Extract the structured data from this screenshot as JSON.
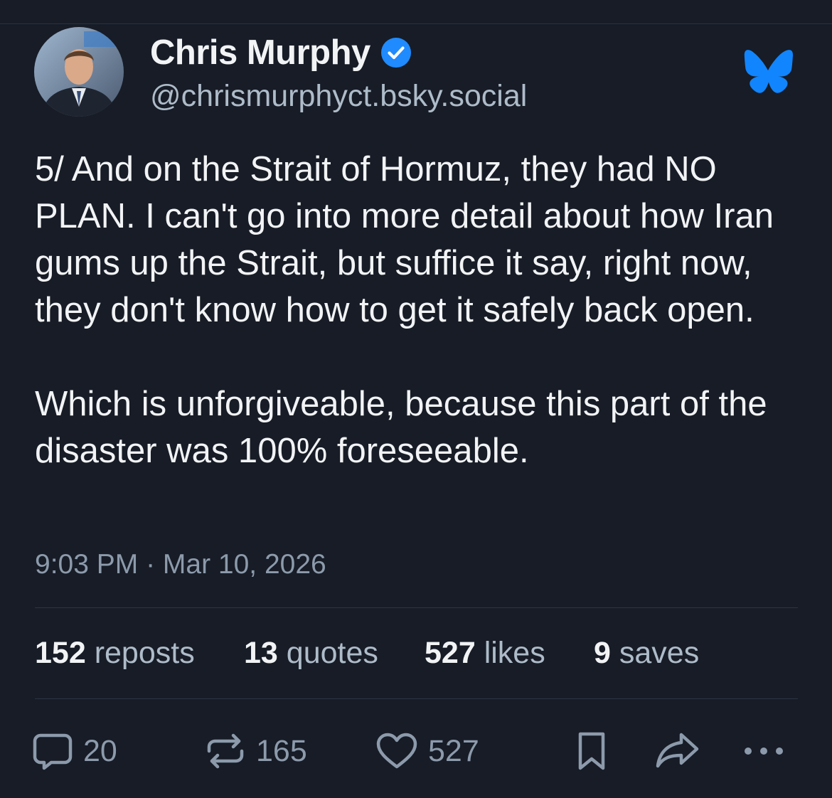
{
  "author": {
    "display_name": "Chris Murphy",
    "handle": "@chrismurphyct.bsky.social",
    "avatar_icon": "profile-photo"
  },
  "post": {
    "paragraphs": [
      "5/ And on the Strait of Hormuz, they had NO PLAN. I can't go into more detail about how Iran gums up the Strait, but suffice it say, right now, they don't know how to get it safely back open.",
      "Which is unforgiveable, because this part of the disaster was 100% foreseeable."
    ],
    "timestamp": "9:03 PM · Mar 10, 2026"
  },
  "stats": {
    "reposts": {
      "count": "152",
      "label": "reposts"
    },
    "quotes": {
      "count": "13",
      "label": "quotes"
    },
    "likes": {
      "count": "527",
      "label": "likes"
    },
    "saves": {
      "count": "9",
      "label": "saves"
    }
  },
  "actions": {
    "reply": {
      "icon": "reply-icon",
      "count": "20"
    },
    "repost": {
      "icon": "repost-icon",
      "count": "165"
    },
    "like": {
      "icon": "heart-icon",
      "count": "527"
    },
    "bookmark": {
      "icon": "bookmark-icon"
    },
    "share": {
      "icon": "share-icon"
    },
    "more": {
      "icon": "more-icon"
    }
  },
  "colors": {
    "background": "#171c26",
    "text_primary": "#f1f3f5",
    "text_secondary": "#aebbc9",
    "text_muted": "#8c9aab",
    "verified_blue": "#208bfe",
    "bluesky_blue": "#1185fe"
  }
}
